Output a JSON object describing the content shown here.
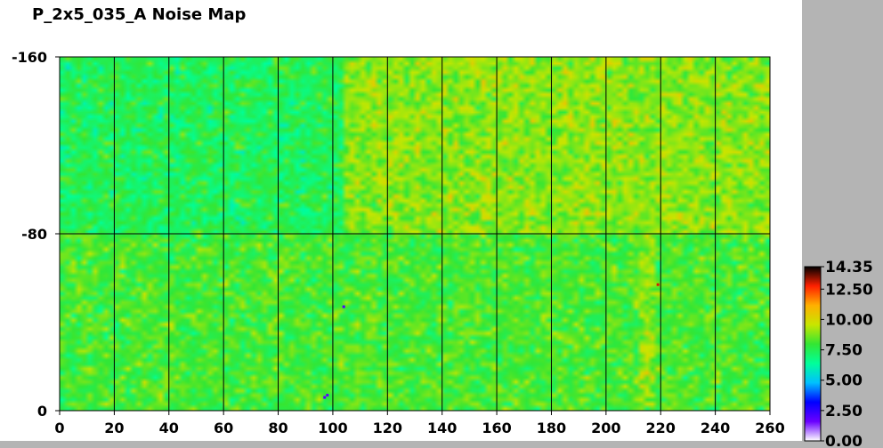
{
  "title": "P_2x5_035_A Noise Map",
  "chart_data": {
    "type": "heatmap",
    "title": "P_2x5_035_A Noise Map",
    "xlim": [
      0,
      260
    ],
    "ylim": [
      0,
      160
    ],
    "x_ticks": [
      "0",
      "20",
      "40",
      "60",
      "80",
      "100",
      "120",
      "140",
      "160",
      "180",
      "200",
      "220",
      "240",
      "260"
    ],
    "y_ticks": [
      "0",
      "-80",
      "-160"
    ],
    "grid": true,
    "grid_x": [
      20,
      40,
      60,
      80,
      100,
      120,
      140,
      160,
      180,
      200,
      220,
      240
    ],
    "grid_y": [
      80
    ],
    "colorbar": {
      "min": 0.0,
      "max": 14.35,
      "labels": [
        "14.35",
        "12.50",
        "10.00",
        "7.50",
        "5.00",
        "2.50",
        "0.00"
      ],
      "colors": [
        "#ffffff",
        "#6a00ff",
        "#0000ff",
        "#00c0ff",
        "#00ff9a",
        "#33e633",
        "#c8e600",
        "#ffb000",
        "#ff2000",
        "#000000"
      ]
    },
    "regions": [
      {
        "x": [
          0,
          104
        ],
        "y": [
          80,
          160
        ],
        "mean": 7.4
      },
      {
        "x": [
          104,
          260
        ],
        "y": [
          80,
          160
        ],
        "mean": 8.9
      },
      {
        "x": [
          0,
          260
        ],
        "y": [
          0,
          80
        ],
        "mean": 8.1
      }
    ],
    "hot_columns": [
      {
        "x": [
          212,
          218
        ],
        "y": [
          0,
          80
        ],
        "mean": 9.0
      }
    ],
    "outliers": [
      {
        "x": 219,
        "y": 57,
        "value": 13.0
      },
      {
        "x": 104,
        "y": 47,
        "value": 2.0
      },
      {
        "x": 97,
        "y": 6,
        "value": 1.8
      },
      {
        "x": 98,
        "y": 7,
        "value": 1.8
      }
    ]
  }
}
